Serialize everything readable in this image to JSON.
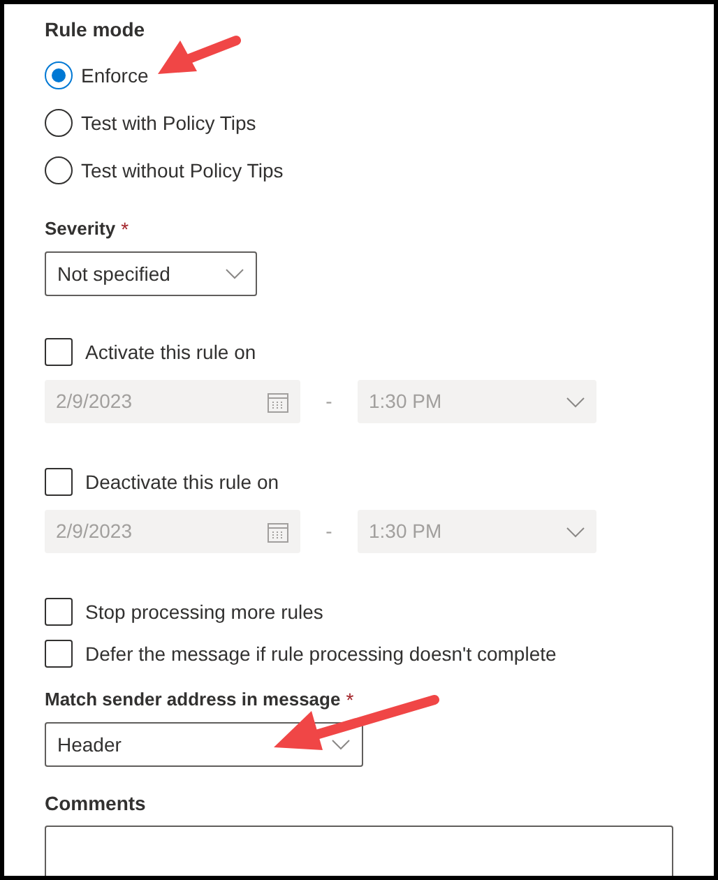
{
  "rule_mode": {
    "label": "Rule mode",
    "options": [
      {
        "label": "Enforce",
        "selected": true
      },
      {
        "label": "Test with Policy Tips",
        "selected": false
      },
      {
        "label": "Test without Policy Tips",
        "selected": false
      }
    ]
  },
  "severity": {
    "label": "Severity",
    "required_mark": "*",
    "value": "Not specified"
  },
  "schedule": [
    {
      "label": "Activate this rule on",
      "checked": false,
      "date": "2/9/2023",
      "separator": "-",
      "time": "1:30 PM"
    },
    {
      "label": "Deactivate this rule on",
      "checked": false,
      "date": "2/9/2023",
      "separator": "-",
      "time": "1:30 PM"
    }
  ],
  "options": [
    {
      "label": "Stop processing more rules",
      "checked": false
    },
    {
      "label": "Defer the message if rule processing doesn't complete",
      "checked": false
    }
  ],
  "match_sender": {
    "label": "Match sender address in message",
    "required_mark": "*",
    "value": "Header"
  },
  "comments": {
    "label": "Comments"
  }
}
